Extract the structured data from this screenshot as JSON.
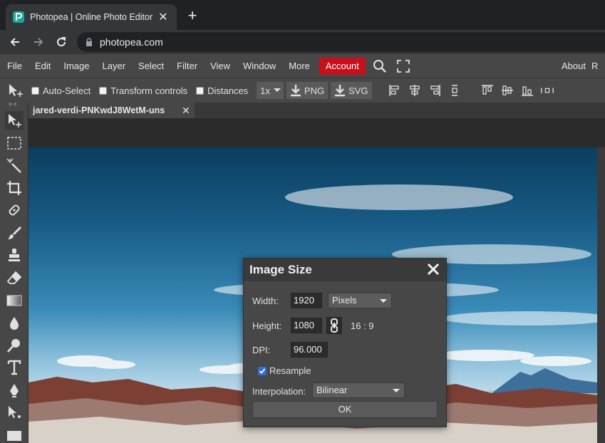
{
  "browser": {
    "tab_title": "Photopea | Online Photo Editor",
    "tab_close": "✕",
    "new_tab": "+",
    "url": "photopea.com"
  },
  "menubar": {
    "items": [
      "File",
      "Edit",
      "Image",
      "Layer",
      "Select",
      "Filter",
      "View",
      "Window",
      "More"
    ],
    "account": "Account",
    "about": "About",
    "cut_item": "R"
  },
  "options": {
    "auto_select": "Auto-Select",
    "transform_controls": "Transform controls",
    "distances": "Distances",
    "zoom": "1x",
    "png": "PNG",
    "svg": "SVG"
  },
  "document": {
    "tab_title": "jared-verdi-PNKwdJ8WetM-uns",
    "tab_close": "✕"
  },
  "dialog": {
    "title": "Image Size",
    "width_label": "Width:",
    "width_value": "1920",
    "unit": "Pixels",
    "height_label": "Height:",
    "height_value": "1080",
    "ratio": "16 : 9",
    "dpi_label": "DPI:",
    "dpi_value": "96.000",
    "resample_label": "Resample",
    "resample_checked": true,
    "interpolation_label": "Interpolation:",
    "interpolation_value": "Bilinear",
    "ok": "OK"
  },
  "colors": {
    "account_bg": "#c8101d",
    "checkbox_accent": "#2a6fd6",
    "favicon": "#1ba698"
  }
}
